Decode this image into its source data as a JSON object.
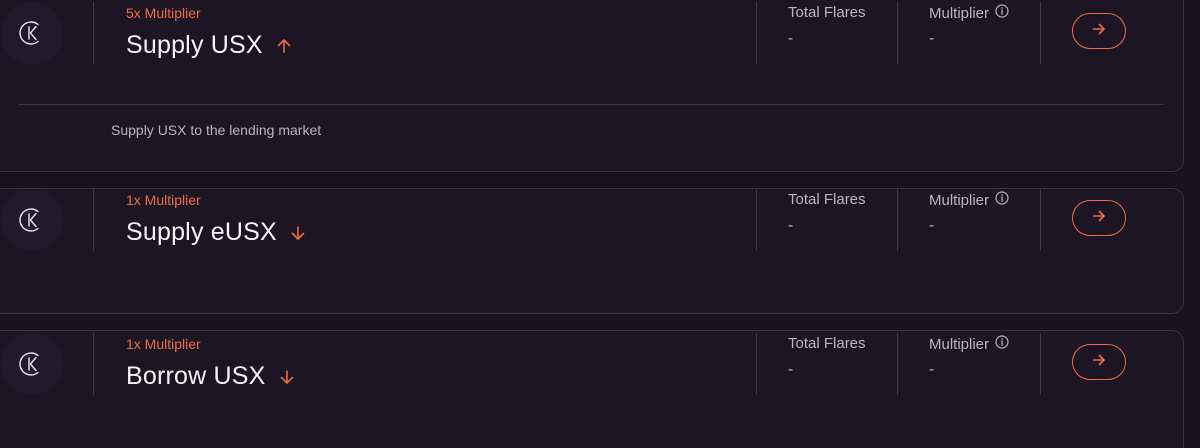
{
  "colors": {
    "accent": "#f06b40",
    "background": "#18131f",
    "card": "#1c1624",
    "border": "#3b3346",
    "muted_text": "#b9b2c2"
  },
  "tasks": [
    {
      "multiplier_label": "5x Multiplier",
      "title": "Supply USX",
      "direction_icon": "arrow-up-icon",
      "total_flares_label": "Total Flares",
      "total_flares_value": "-",
      "multiplier_col_label": "Multiplier",
      "multiplier_col_value": "-",
      "description": "Supply USX to the lending market"
    },
    {
      "multiplier_label": "1x Multiplier",
      "title": "Supply eUSX",
      "direction_icon": "arrow-down-icon",
      "total_flares_label": "Total Flares",
      "total_flares_value": "-",
      "multiplier_col_label": "Multiplier",
      "multiplier_col_value": "-"
    },
    {
      "multiplier_label": "1x Multiplier",
      "title": "Borrow USX",
      "direction_icon": "arrow-down-icon",
      "total_flares_label": "Total Flares",
      "total_flares_value": "-",
      "multiplier_col_label": "Multiplier",
      "multiplier_col_value": "-"
    }
  ]
}
